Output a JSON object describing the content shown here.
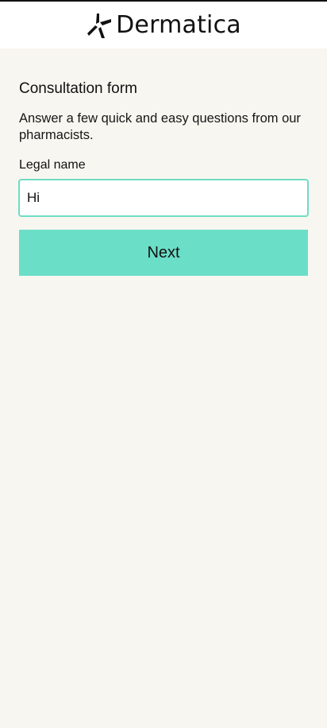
{
  "header": {
    "brand_name": "Dermatica",
    "logo_icon": "pinwheel-logo-icon"
  },
  "form": {
    "title": "Consultation form",
    "intro": "Answer a few quick and easy questions from our pharmacists.",
    "legal_name_label": "Legal name",
    "legal_name_value": "Hi",
    "next_label": "Next"
  },
  "colors": {
    "background": "#f8f6f0",
    "header_background": "#ffffff",
    "accent": "#6bdec8",
    "input_border": "#6fdcc6",
    "text": "#111111"
  }
}
